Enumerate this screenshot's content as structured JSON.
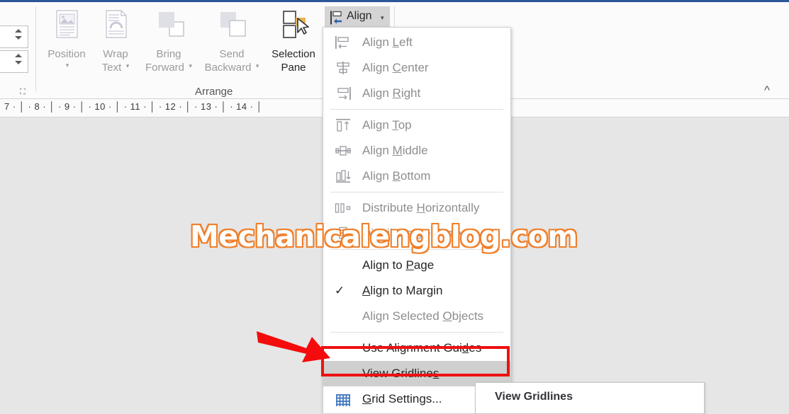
{
  "app": {
    "ribbon_group_label": "Arrange",
    "collapse_icon": "chevron-up-icon"
  },
  "ribbon": {
    "buttons": [
      {
        "label": "Position",
        "sub": "",
        "caret": "▾",
        "enabled": false,
        "icon": "position-icon"
      },
      {
        "label": "Wrap",
        "sub": "Text",
        "caret": "▾",
        "enabled": false,
        "icon": "wrap-text-icon"
      },
      {
        "label": "Bring",
        "sub": "Forward",
        "caret": "▾",
        "enabled": false,
        "icon": "bring-forward-icon"
      },
      {
        "label": "Send",
        "sub": "Backward",
        "caret": "▾",
        "enabled": false,
        "icon": "send-backward-icon"
      },
      {
        "label": "Selection",
        "sub": "Pane",
        "caret": "",
        "enabled": true,
        "icon": "selection-pane-icon"
      }
    ],
    "align_button": {
      "label": "Align",
      "caret": "▾",
      "icon": "align-icon"
    }
  },
  "ruler": {
    "marks": "7 ·  │  · 8 ·  │  · 9 ·  │  · 10 ·  │  · 11 ·  │  · 12 ·  │  · 13 ·  │  · 14 ·  │"
  },
  "menu": {
    "items": [
      {
        "label": "Align Left",
        "icon": "align-left-icon",
        "enabled": false,
        "checked": false,
        "selected": false,
        "sep_after": false
      },
      {
        "label": "Align Center",
        "icon": "align-center-icon",
        "enabled": false,
        "checked": false,
        "selected": false,
        "sep_after": false
      },
      {
        "label": "Align Right",
        "icon": "align-right-icon",
        "enabled": false,
        "checked": false,
        "selected": false,
        "sep_after": true
      },
      {
        "label": "Align Top",
        "icon": "align-top-icon",
        "enabled": false,
        "checked": false,
        "selected": false,
        "sep_after": false
      },
      {
        "label": "Align Middle",
        "icon": "align-middle-icon",
        "enabled": false,
        "checked": false,
        "selected": false,
        "sep_after": false
      },
      {
        "label": "Align Bottom",
        "icon": "align-bottom-icon",
        "enabled": false,
        "checked": false,
        "selected": false,
        "sep_after": true
      },
      {
        "label": "Distribute Horizontally",
        "icon": "distribute-h-icon",
        "enabled": false,
        "checked": false,
        "selected": false,
        "sep_after": false
      },
      {
        "label": "Distribute Vertically",
        "icon": "distribute-v-icon",
        "enabled": false,
        "checked": false,
        "selected": false,
        "sep_after": true
      },
      {
        "label": "Align to Page",
        "icon": "",
        "enabled": true,
        "checked": false,
        "selected": false,
        "sep_after": false
      },
      {
        "label": "Align to Margin",
        "icon": "",
        "enabled": true,
        "checked": true,
        "selected": false,
        "sep_after": false
      },
      {
        "label": "Align Selected Objects",
        "icon": "",
        "enabled": false,
        "checked": false,
        "selected": false,
        "sep_after": true
      },
      {
        "label": "Use Alignment Guides",
        "icon": "",
        "enabled": true,
        "checked": false,
        "selected": false,
        "sep_after": false
      },
      {
        "label": "View Gridlines",
        "icon": "",
        "enabled": true,
        "checked": false,
        "selected": true,
        "sep_after": false
      },
      {
        "label": "Grid Settings...",
        "icon": "grid-settings-icon",
        "enabled": true,
        "checked": false,
        "selected": false,
        "sep_after": false
      }
    ]
  },
  "tooltip": {
    "title": "View Gridlines"
  },
  "annotation": {
    "highlight_color": "#ee1111",
    "arrow_color": "#f40c0c",
    "highlighted_item": "View Gridlines"
  },
  "watermark": {
    "text": "Mechanicalengblog.com",
    "color": "#ef7f2a"
  }
}
